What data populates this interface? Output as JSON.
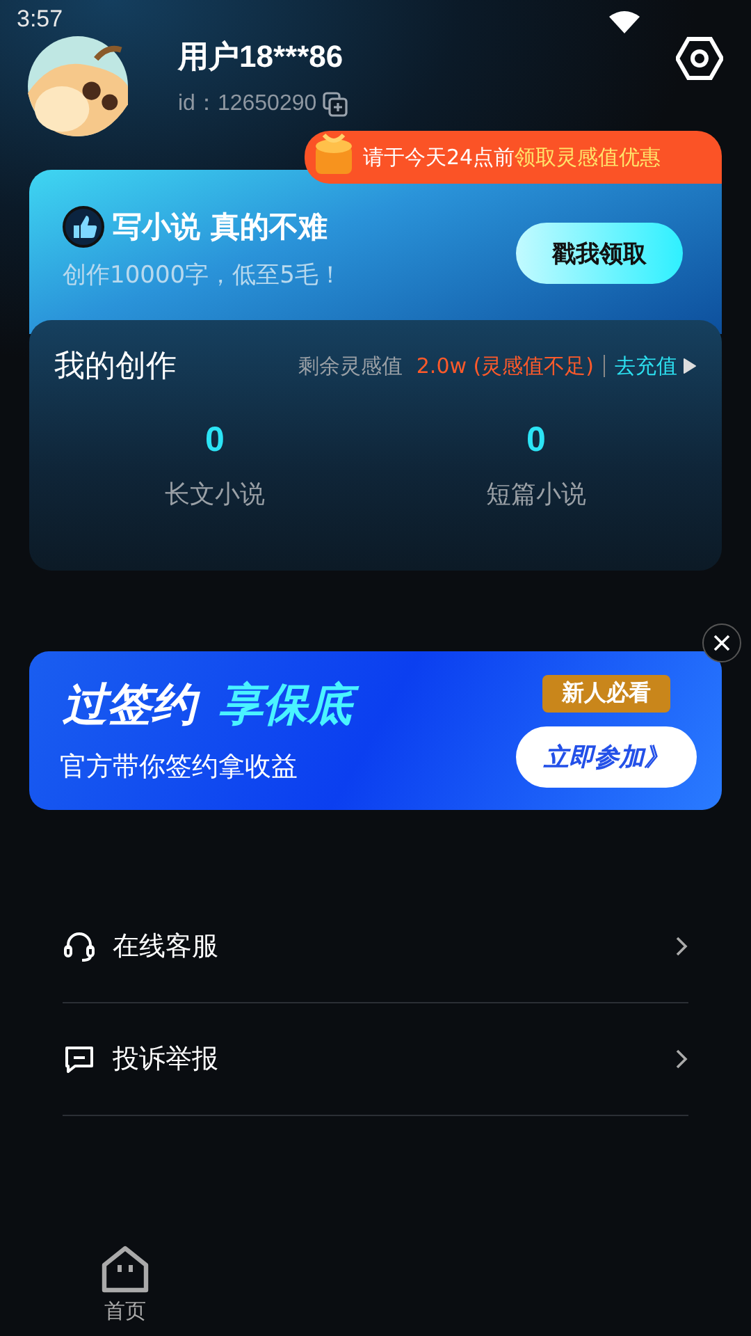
{
  "status_bar": {
    "time": "3:57"
  },
  "profile": {
    "username": "用户18***86",
    "id": "id：12650290"
  },
  "promo_ribbon": {
    "text": "请于今天24点前",
    "highlight": "领取灵感值优惠"
  },
  "banner": {
    "title": "写小说 真的不难",
    "subtitle": "创作10000字，低至5毛！",
    "button": "戳我领取"
  },
  "creation": {
    "title": "我的创作",
    "balance_label": "剩余灵感值",
    "balance": "2.0w (灵感值不足)",
    "recharge": "去充值",
    "stats": [
      {
        "value": "0",
        "label": "长文小说"
      },
      {
        "value": "0",
        "label": "短篇小说"
      }
    ]
  },
  "ad": {
    "title": "过签约",
    "title_highlight": "享保底",
    "subtitle": "官方带你签约拿收益",
    "tag": "新人必看",
    "button": "立即参加》"
  },
  "menu": [
    {
      "kind": "headset",
      "label": "在线客服"
    },
    {
      "kind": "chat",
      "label": "投诉举报"
    }
  ],
  "nav": [
    {
      "label": "首页"
    }
  ]
}
